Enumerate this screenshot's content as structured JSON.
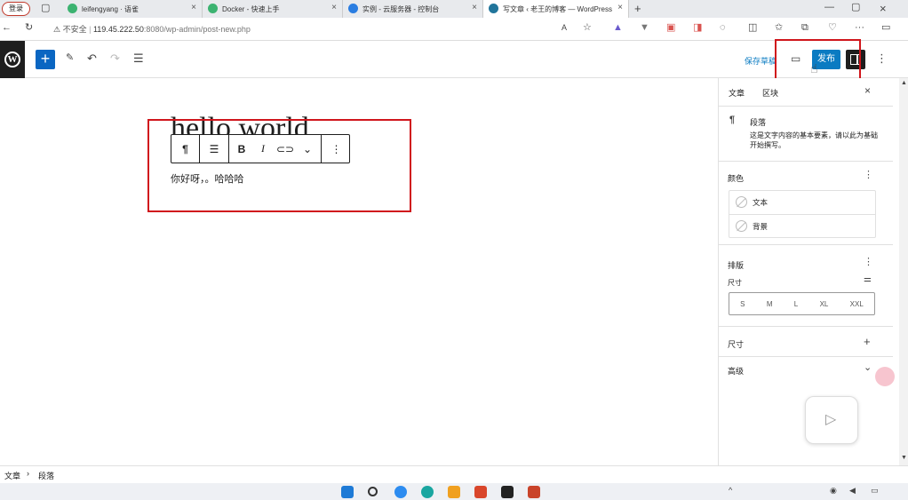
{
  "browser": {
    "profile_label": "登录",
    "tabs": [
      {
        "title": "leifengyang · 语雀",
        "color": "#3cb371"
      },
      {
        "title": "Docker - 快速上手",
        "color": "#3cb371"
      },
      {
        "title": "实例 - 云服务器 - 控制台",
        "color": "#2a7de1"
      },
      {
        "title": "写文章 ‹ 老王的博客 — WordPress",
        "color": "#21759b"
      }
    ],
    "url_prefix": "不安全",
    "url_host": "119.45.222.50",
    "url_path": ":8080/wp-admin/post-new.php"
  },
  "editor": {
    "save_draft": "保存草稿",
    "publish": "发布",
    "post_title": "hello world",
    "paragraph_text": "你好呀，。哈哈哈",
    "toolbar": {
      "paragraph_icon": "¶",
      "bold": "B",
      "italic": "I"
    }
  },
  "sidebar": {
    "tab_post": "文章",
    "tab_block": "区块",
    "block_name": "段落",
    "block_desc": "这是文字内容的基本要素，请以此为基础开始撰写。",
    "color_section": "颜色",
    "color_text": "文本",
    "color_background": "背景",
    "typography_section": "排版",
    "size_label": "尺寸",
    "sizes": [
      "S",
      "M",
      "L",
      "XL",
      "XXL"
    ],
    "dimensions_section": "尺寸",
    "advanced_section": "高级"
  },
  "footer": {
    "breadcrumb_root": "文章",
    "breadcrumb_sep": "›",
    "breadcrumb_current": "段落"
  }
}
